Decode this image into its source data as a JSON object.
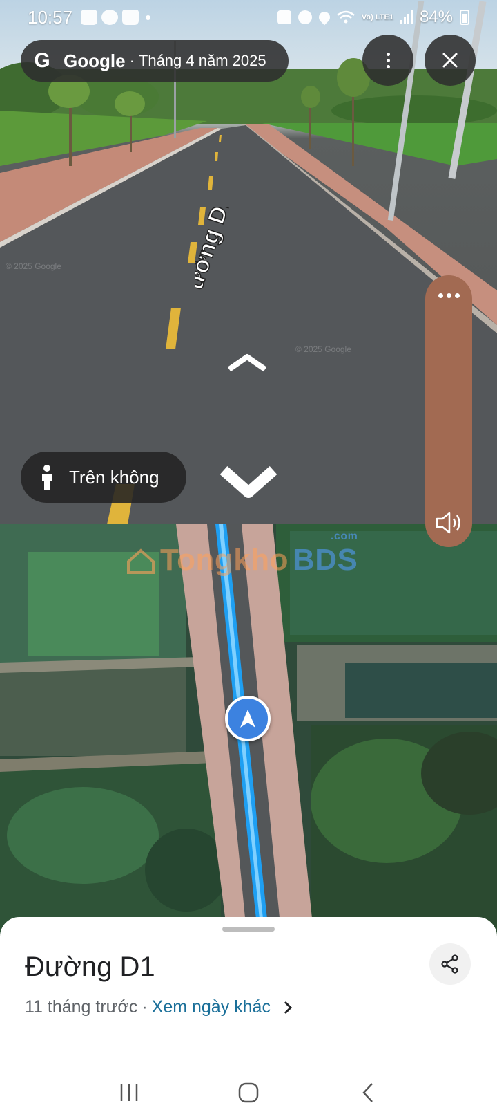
{
  "status_bar": {
    "time": "10:57",
    "network_label": "Vo) LTE1",
    "battery": "84%"
  },
  "street_view": {
    "brand": "Google",
    "separator": "·",
    "capture_date": "Tháng 4 năm 2025",
    "road_label": "Đường D1",
    "aerial_button_label": "Trên không",
    "watermark": "© 2025 Google"
  },
  "map": {
    "watermark_left": "Tongkho",
    "watermark_right": "BDS",
    "watermark_suffix": ".com"
  },
  "sheet": {
    "title": "Đường D1",
    "age": "11 tháng trước",
    "dot": "·",
    "other_dates_link": "Xem ngày khác"
  },
  "icons": {
    "google": "google-g-icon",
    "more": "more-vertical-icon",
    "close": "close-icon",
    "person": "person-icon",
    "sound": "volume-icon",
    "share": "share-icon",
    "chevron": "chevron-right-icon",
    "marker": "navigation-arrow-icon"
  },
  "colors": {
    "sidebar_panel": "#a26a52",
    "route_blue": "#1e9ff2",
    "link_teal": "#1a6f99",
    "marker_blue": "#3c82e0"
  }
}
